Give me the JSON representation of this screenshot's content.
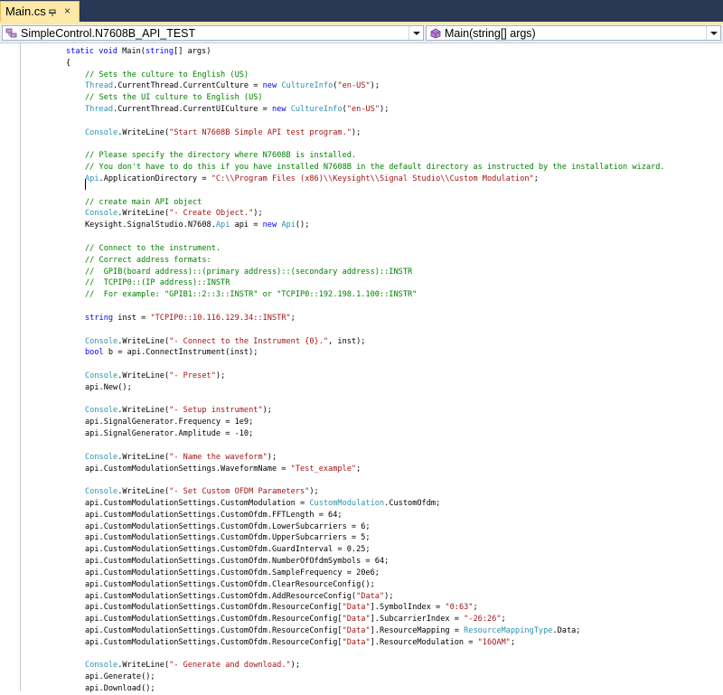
{
  "tab": {
    "title": "Main.cs",
    "close_glyph": "×"
  },
  "nav": {
    "class_combo": "SimpleControl.N7608B_API_TEST",
    "method_combo": "Main(string[] args)"
  },
  "code_lines": [
    [
      {
        "t": "static void",
        "c": "k"
      },
      {
        "t": " Main("
      },
      {
        "t": "string",
        "c": "k"
      },
      {
        "t": "[] args)"
      }
    ],
    [
      {
        "t": "{"
      }
    ],
    [
      {
        "t": "// Sets the culture to English (US)",
        "c": "c"
      }
    ],
    [
      {
        "t": "Thread",
        "c": "t"
      },
      {
        "t": ".CurrentThread.CurrentCulture = "
      },
      {
        "t": "new",
        "c": "k"
      },
      {
        "t": " "
      },
      {
        "t": "CultureInfo",
        "c": "t"
      },
      {
        "t": "("
      },
      {
        "t": "\"en-US\"",
        "c": "s"
      },
      {
        "t": ");"
      }
    ],
    [
      {
        "t": "// Sets the UI culture to English (US)",
        "c": "c"
      }
    ],
    [
      {
        "t": "Thread",
        "c": "t"
      },
      {
        "t": ".CurrentThread.CurrentUICulture = "
      },
      {
        "t": "new",
        "c": "k"
      },
      {
        "t": " "
      },
      {
        "t": "CultureInfo",
        "c": "t"
      },
      {
        "t": "("
      },
      {
        "t": "\"en-US\"",
        "c": "s"
      },
      {
        "t": ");"
      }
    ],
    [],
    [
      {
        "t": "Console",
        "c": "t"
      },
      {
        "t": ".WriteLine("
      },
      {
        "t": "\"Start N7608B Simple API test program.\"",
        "c": "s"
      },
      {
        "t": ");"
      }
    ],
    [],
    [
      {
        "t": "// Please specify the directory where N7608B is installed.",
        "c": "c"
      }
    ],
    [
      {
        "t": "// You don't have to do this if you have installed N7608B in the default directory as instructed by the installation wizard.",
        "c": "c"
      }
    ],
    [
      {
        "t": "Api",
        "c": "t"
      },
      {
        "t": ".ApplicationDirectory = "
      },
      {
        "t": "\"C:\\\\Program Files (x86)\\\\Keysight\\\\Signal Studio\\\\Custom Modulation\"",
        "c": "s"
      },
      {
        "t": ";"
      }
    ],
    [],
    [
      {
        "t": "// create main API object",
        "c": "c"
      }
    ],
    [
      {
        "t": "Console",
        "c": "t"
      },
      {
        "t": ".WriteLine("
      },
      {
        "t": "\"- Create Object.\"",
        "c": "s"
      },
      {
        "t": ");"
      }
    ],
    [
      {
        "t": "Keysight.SignalStudio.N7608."
      },
      {
        "t": "Api",
        "c": "t"
      },
      {
        "t": " api = "
      },
      {
        "t": "new",
        "c": "k"
      },
      {
        "t": " "
      },
      {
        "t": "Api",
        "c": "t"
      },
      {
        "t": "();"
      }
    ],
    [],
    [
      {
        "t": "// Connect to the instrument.",
        "c": "c"
      }
    ],
    [
      {
        "t": "// Correct address formats:",
        "c": "c"
      }
    ],
    [
      {
        "t": "//  GPIB(board address)::(primary address)::(secondary address)::INSTR",
        "c": "c"
      }
    ],
    [
      {
        "t": "//  TCPIP0::(IP address)::INSTR",
        "c": "c"
      }
    ],
    [
      {
        "t": "//  For example: \"GPIB1::2::3::INSTR\" or \"TCPIP0::192.198.1.100::INSTR\"",
        "c": "c"
      }
    ],
    [],
    [
      {
        "t": "string",
        "c": "k"
      },
      {
        "t": " inst = "
      },
      {
        "t": "\"TCPIP0::10.116.129.34::INSTR\"",
        "c": "s"
      },
      {
        "t": ";"
      }
    ],
    [],
    [
      {
        "t": "Console",
        "c": "t"
      },
      {
        "t": ".WriteLine("
      },
      {
        "t": "\"- Connect to the Instrument {0}.\"",
        "c": "s"
      },
      {
        "t": ", inst);"
      }
    ],
    [
      {
        "t": "bool",
        "c": "k"
      },
      {
        "t": " b = api.ConnectInstrument(inst);"
      }
    ],
    [],
    [
      {
        "t": "Console",
        "c": "t"
      },
      {
        "t": ".WriteLine("
      },
      {
        "t": "\"- Preset\"",
        "c": "s"
      },
      {
        "t": ");"
      }
    ],
    [
      {
        "t": "api.New();"
      }
    ],
    [],
    [
      {
        "t": "Console",
        "c": "t"
      },
      {
        "t": ".WriteLine("
      },
      {
        "t": "\"- Setup instrument\"",
        "c": "s"
      },
      {
        "t": ");"
      }
    ],
    [
      {
        "t": "api.SignalGenerator.Frequency = 1e9;"
      }
    ],
    [
      {
        "t": "api.SignalGenerator.Amplitude = -10;"
      }
    ],
    [],
    [
      {
        "t": "Console",
        "c": "t"
      },
      {
        "t": ".WriteLine("
      },
      {
        "t": "\"- Name the waveform\"",
        "c": "s"
      },
      {
        "t": ");"
      }
    ],
    [
      {
        "t": "api.CustomModulationSettings.WaveformName = "
      },
      {
        "t": "\"Test_example\"",
        "c": "s"
      },
      {
        "t": ";"
      }
    ],
    [],
    [
      {
        "t": "Console",
        "c": "t"
      },
      {
        "t": ".WriteLine("
      },
      {
        "t": "\"- Set Custom OFDM Parameters\"",
        "c": "s"
      },
      {
        "t": ");"
      }
    ],
    [
      {
        "t": "api.CustomModulationSettings.CustomModulation = "
      },
      {
        "t": "CustomModulation",
        "c": "t"
      },
      {
        "t": ".CustomOfdm;"
      }
    ],
    [
      {
        "t": "api.CustomModulationSettings.CustomOfdm.FFTLength = 64;"
      }
    ],
    [
      {
        "t": "api.CustomModulationSettings.CustomOfdm.LowerSubcarriers = 6;"
      }
    ],
    [
      {
        "t": "api.CustomModulationSettings.CustomOfdm.UpperSubcarriers = 5;"
      }
    ],
    [
      {
        "t": "api.CustomModulationSettings.CustomOfdm.GuardInterval = 0.25;"
      }
    ],
    [
      {
        "t": "api.CustomModulationSettings.CustomOfdm.NumberOfOfdmSymbols = 64;"
      }
    ],
    [
      {
        "t": "api.CustomModulationSettings.CustomOfdm.SampleFrequency = 20e6;"
      }
    ],
    [
      {
        "t": "api.CustomModulationSettings.CustomOfdm.ClearResourceConfig();"
      }
    ],
    [
      {
        "t": "api.CustomModulationSettings.CustomOfdm.AddResourceConfig("
      },
      {
        "t": "\"Data\"",
        "c": "s"
      },
      {
        "t": ");"
      }
    ],
    [
      {
        "t": "api.CustomModulationSettings.CustomOfdm.ResourceConfig["
      },
      {
        "t": "\"Data\"",
        "c": "s"
      },
      {
        "t": "].SymbolIndex = "
      },
      {
        "t": "\"0:63\"",
        "c": "s"
      },
      {
        "t": ";"
      }
    ],
    [
      {
        "t": "api.CustomModulationSettings.CustomOfdm.ResourceConfig["
      },
      {
        "t": "\"Data\"",
        "c": "s"
      },
      {
        "t": "].SubcarrierIndex = "
      },
      {
        "t": "\"-26:26\"",
        "c": "s"
      },
      {
        "t": ";"
      }
    ],
    [
      {
        "t": "api.CustomModulationSettings.CustomOfdm.ResourceConfig["
      },
      {
        "t": "\"Data\"",
        "c": "s"
      },
      {
        "t": "].ResourceMapping = "
      },
      {
        "t": "ResourceMappingType",
        "c": "t"
      },
      {
        "t": ".Data;"
      }
    ],
    [
      {
        "t": "api.CustomModulationSettings.CustomOfdm.ResourceConfig["
      },
      {
        "t": "\"Data\"",
        "c": "s"
      },
      {
        "t": "].ResourceModulation = "
      },
      {
        "t": "\"16QAM\"",
        "c": "s"
      },
      {
        "t": ";"
      }
    ],
    [],
    [
      {
        "t": "Console",
        "c": "t"
      },
      {
        "t": ".WriteLine("
      },
      {
        "t": "\"- Generate and download.\"",
        "c": "s"
      },
      {
        "t": ");"
      }
    ],
    [
      {
        "t": "api.Generate();"
      }
    ],
    [
      {
        "t": "api.Download();"
      }
    ]
  ],
  "colors": {
    "comment": "#008000",
    "keyword": "#0000ff",
    "string": "#a31515",
    "type": "#2b91af",
    "tab_bar": "#293955",
    "tab_active": "#fde9a8"
  }
}
